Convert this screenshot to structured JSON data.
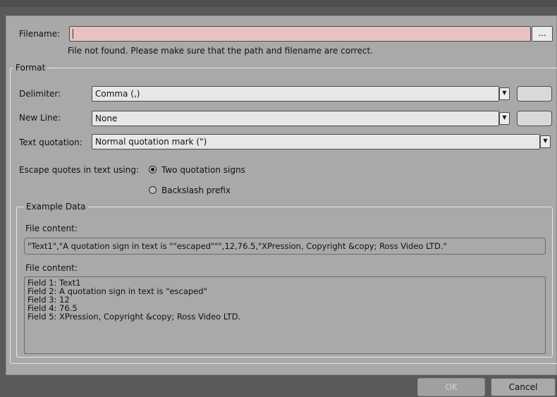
{
  "filename": {
    "label": "Filename:",
    "value": "",
    "browse_label": "...",
    "error": "File not found. Please make sure that the path and filename are correct."
  },
  "format": {
    "legend": "Format",
    "delimiter": {
      "label": "Delimiter:",
      "value": "Comma (,)"
    },
    "new_line": {
      "label": "New Line:",
      "value": "None"
    },
    "text_quotation": {
      "label": "Text quotation:",
      "value": "Normal quotation mark (\")"
    },
    "escape": {
      "label": "Escape quotes in text using:",
      "options": [
        {
          "label": "Two quotation signs",
          "selected": true
        },
        {
          "label": "Backslash prefix",
          "selected": false
        }
      ]
    }
  },
  "example": {
    "legend": "Example Data",
    "file_content_label_1": "File content:",
    "raw_line": "\"Text1\",\"A quotation sign in text is \"\"escaped\"\"\",12,76.5,\"XPression, Copyright &copy; Ross Video LTD.\"",
    "file_content_label_2": "File content:",
    "fields": [
      "Field 1: Text1",
      "Field 2: A quotation sign in text is \"escaped\"",
      "Field 3: 12",
      "Field 4: 76.5",
      "Field 5: XPression, Copyright &copy; Ross Video LTD."
    ]
  },
  "buttons": {
    "ok": "OK",
    "cancel": "Cancel"
  }
}
